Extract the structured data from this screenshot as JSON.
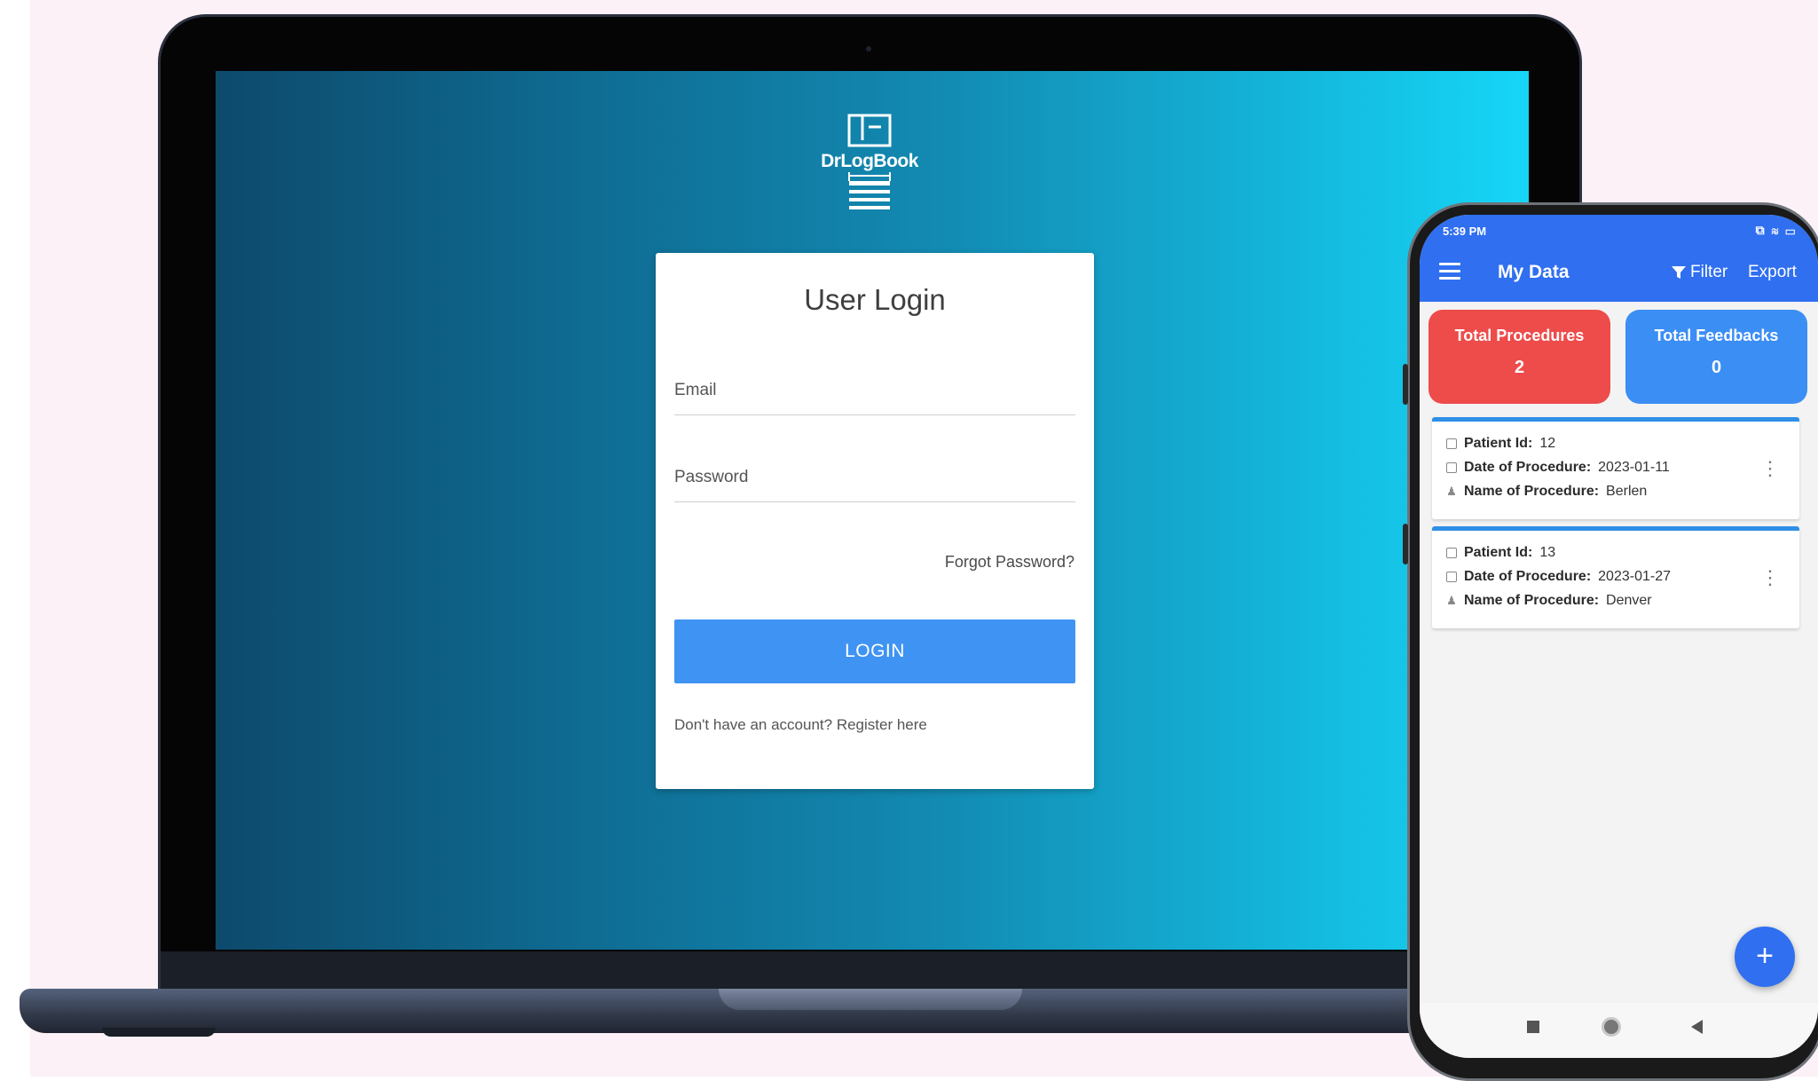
{
  "laptop": {
    "logo_text": "DrLogBook",
    "login": {
      "title": "User Login",
      "email_label": "Email",
      "password_label": "Password",
      "forgot_password": "Forgot Password?",
      "login_button": "LOGIN",
      "register_text": "Don't have an account? Register here"
    }
  },
  "phone": {
    "status_bar": {
      "time": "5:39 PM",
      "icons": "⧉ ≋ ▭"
    },
    "app_bar": {
      "title": "My Data",
      "filter_label": "Filter",
      "export_label": "Export"
    },
    "stats": {
      "procedures_label": "Total Procedures",
      "procedures_value": "2",
      "feedbacks_label": "Total Feedbacks",
      "feedbacks_value": "0"
    },
    "field_labels": {
      "patient_id": "Patient Id:",
      "date": "Date of Procedure:",
      "name": "Name of Procedure:"
    },
    "records": [
      {
        "patient_id": "12",
        "date": "2023-01-11",
        "name": "Berlen"
      },
      {
        "patient_id": "13",
        "date": "2023-01-27",
        "name": "Denver"
      }
    ],
    "fab_label": "+",
    "colors": {
      "primary": "#2f6ff0",
      "procedures_card": "#ee4b4b",
      "feedbacks_card": "#3b8ef4",
      "record_accent": "#2f8fe6"
    }
  },
  "icons": {
    "menu": "menu-icon",
    "filter": "filter-icon",
    "calendar": "calendar-icon",
    "person": "person-icon",
    "kebab": "more-vert-icon",
    "add": "add-icon"
  }
}
